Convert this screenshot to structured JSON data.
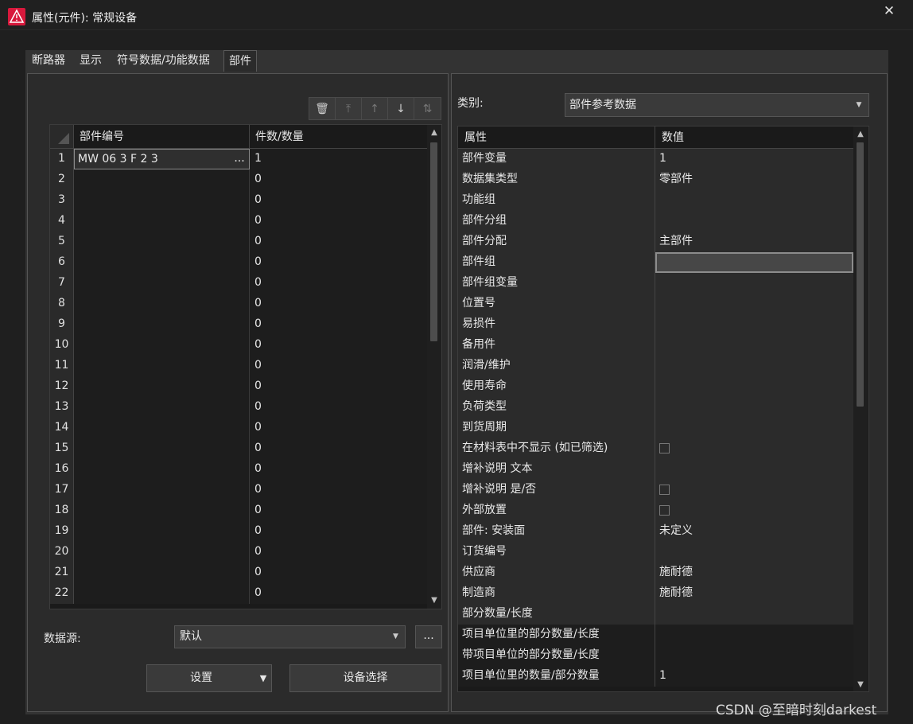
{
  "window": {
    "title": "属性(元件): 常规设备",
    "close_glyph": "✕"
  },
  "tabs": [
    "断路器",
    "显示",
    "符号数据/功能数据",
    "部件"
  ],
  "active_tab": 3,
  "toolbar": {
    "delete": "🗑",
    "move_top": "⤒",
    "move_up": "↑",
    "move_down": "↓",
    "sort": "⇅"
  },
  "parts_table": {
    "headers": [
      "部件编号",
      "件数/数量"
    ],
    "rows": [
      {
        "n": "1",
        "part": "MW 06 3 F 2 3",
        "qty": "1"
      },
      {
        "n": "2",
        "part": "",
        "qty": "0"
      },
      {
        "n": "3",
        "part": "",
        "qty": "0"
      },
      {
        "n": "4",
        "part": "",
        "qty": "0"
      },
      {
        "n": "5",
        "part": "",
        "qty": "0"
      },
      {
        "n": "6",
        "part": "",
        "qty": "0"
      },
      {
        "n": "7",
        "part": "",
        "qty": "0"
      },
      {
        "n": "8",
        "part": "",
        "qty": "0"
      },
      {
        "n": "9",
        "part": "",
        "qty": "0"
      },
      {
        "n": "10",
        "part": "",
        "qty": "0"
      },
      {
        "n": "11",
        "part": "",
        "qty": "0"
      },
      {
        "n": "12",
        "part": "",
        "qty": "0"
      },
      {
        "n": "13",
        "part": "",
        "qty": "0"
      },
      {
        "n": "14",
        "part": "",
        "qty": "0"
      },
      {
        "n": "15",
        "part": "",
        "qty": "0"
      },
      {
        "n": "16",
        "part": "",
        "qty": "0"
      },
      {
        "n": "17",
        "part": "",
        "qty": "0"
      },
      {
        "n": "18",
        "part": "",
        "qty": "0"
      },
      {
        "n": "19",
        "part": "",
        "qty": "0"
      },
      {
        "n": "20",
        "part": "",
        "qty": "0"
      },
      {
        "n": "21",
        "part": "",
        "qty": "0"
      },
      {
        "n": "22",
        "part": "",
        "qty": "0"
      }
    ],
    "edit_button": "..."
  },
  "datasource": {
    "label": "数据源:",
    "value": "默认",
    "more": "..."
  },
  "buttons": {
    "settings": "设置",
    "device_select": "设备选择"
  },
  "category": {
    "label": "类别:",
    "value": "部件参考数据"
  },
  "properties": {
    "headers": [
      "属性",
      "数值"
    ],
    "rows": [
      {
        "name": "部件变量",
        "value": "1"
      },
      {
        "name": "数据集类型",
        "value": "零部件"
      },
      {
        "name": "功能组",
        "value": ""
      },
      {
        "name": "部件分组",
        "value": ""
      },
      {
        "name": "部件分配",
        "value": "主部件"
      },
      {
        "name": "部件组",
        "value": "",
        "editing": true
      },
      {
        "name": "部件组变量",
        "value": ""
      },
      {
        "name": "位置号",
        "value": ""
      },
      {
        "name": "易损件",
        "value": ""
      },
      {
        "name": "备用件",
        "value": ""
      },
      {
        "name": "润滑/维护",
        "value": ""
      },
      {
        "name": "使用寿命",
        "value": ""
      },
      {
        "name": "负荷类型",
        "value": ""
      },
      {
        "name": "到货周期",
        "value": ""
      },
      {
        "name": "在材料表中不显示 (如已筛选)",
        "checkbox": true
      },
      {
        "name": "增补说明 文本",
        "value": ""
      },
      {
        "name": "增补说明 是/否",
        "checkbox": true
      },
      {
        "name": "外部放置",
        "checkbox": true
      },
      {
        "name": "部件: 安装面",
        "value": "未定义"
      },
      {
        "name": "订货编号",
        "value": ""
      },
      {
        "name": "供应商",
        "value": "施耐德"
      },
      {
        "name": "制造商",
        "value": "施耐德"
      },
      {
        "name": "部分数量/长度",
        "value": ""
      },
      {
        "name": "项目单位里的部分数量/长度",
        "value": "",
        "dark": true
      },
      {
        "name": "带项目单位的部分数量/长度",
        "value": "",
        "dark": true
      },
      {
        "name": "项目单位里的数量/部分数量",
        "value": "1",
        "dark": true
      }
    ]
  },
  "watermark": "CSDN @至暗时刻darkest",
  "colors": {
    "accent": "#d8183c",
    "background": "#1f1f1f",
    "panel": "#2b2b2b"
  }
}
